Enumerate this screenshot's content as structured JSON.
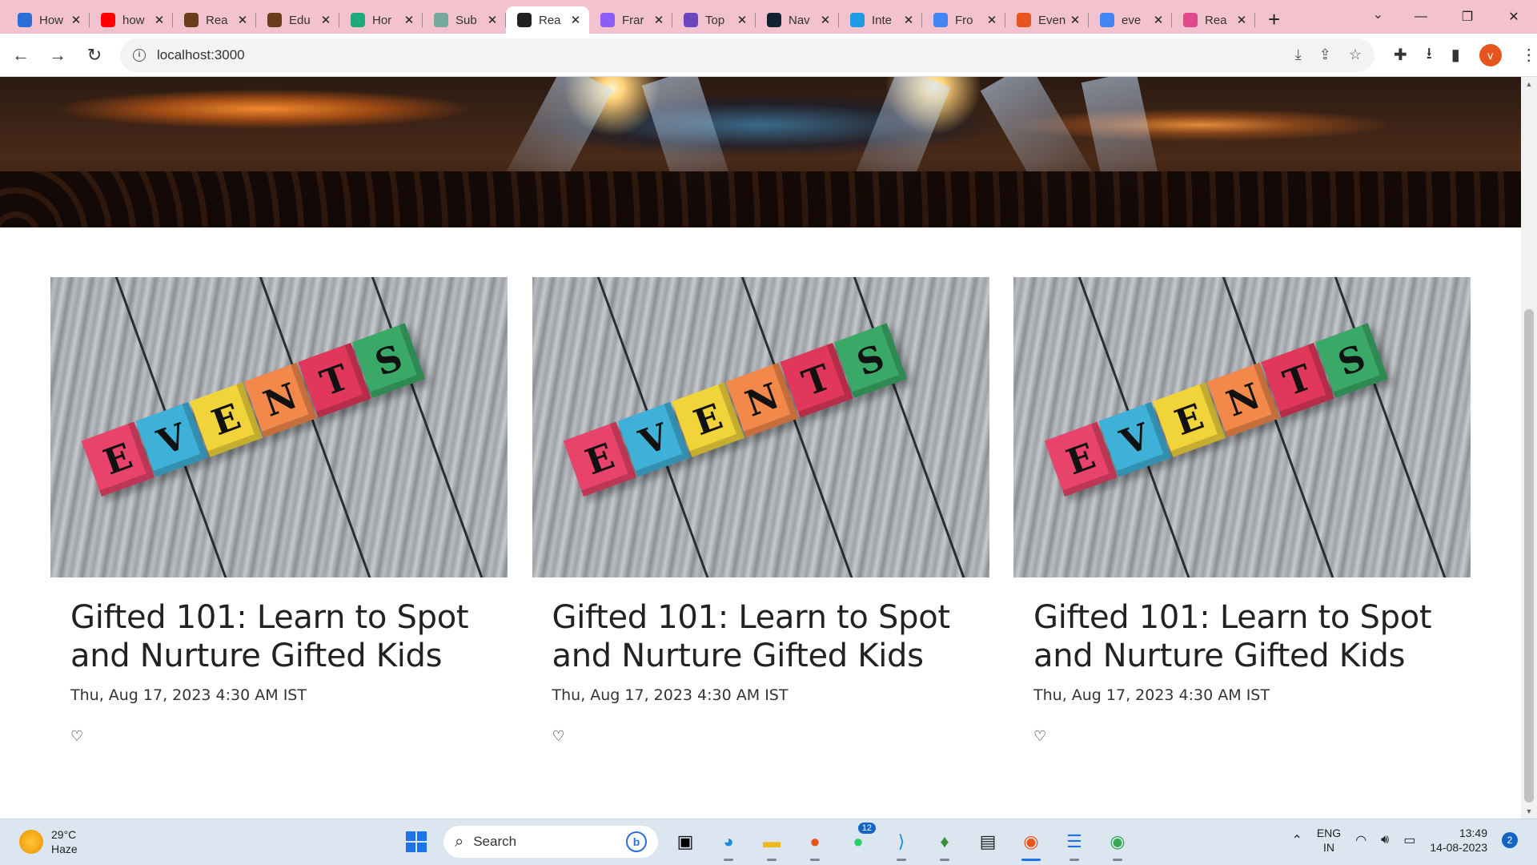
{
  "browser": {
    "tabs": [
      {
        "title": "How",
        "icon": "infinity-icon",
        "color": "#2b6ed6"
      },
      {
        "title": "how",
        "icon": "youtube-icon",
        "color": "#ff0000"
      },
      {
        "title": "Rea",
        "icon": "book-icon",
        "color": "#6b3c1a"
      },
      {
        "title": "Edu",
        "icon": "book-icon",
        "color": "#6b3c1a"
      },
      {
        "title": "Hor",
        "icon": "circle-check-icon",
        "color": "#1ea97c"
      },
      {
        "title": "Sub",
        "icon": "openai-icon",
        "color": "#74aa9c"
      },
      {
        "title": "Rea",
        "icon": "react-icon",
        "color": "#222222",
        "active": true
      },
      {
        "title": "Frar",
        "icon": "framer-icon",
        "color": "#8b5cf6"
      },
      {
        "title": "Top",
        "icon": "bell-icon",
        "color": "#6b46c1"
      },
      {
        "title": "Nav",
        "icon": "rb-icon",
        "color": "#112233"
      },
      {
        "title": "Inte",
        "icon": "is-icon",
        "color": "#1b9ce3"
      },
      {
        "title": "Fro",
        "icon": "doc-icon",
        "color": "#4285f4"
      },
      {
        "title": "Even",
        "icon": "e-icon",
        "color": "#e8541e"
      },
      {
        "title": "eve",
        "icon": "google-icon",
        "color": "#4285f4"
      },
      {
        "title": "Rea",
        "icon": "react-icon",
        "color": "#e04a8c"
      }
    ],
    "new_tab": "+",
    "url": "localhost:3000",
    "profile_initial": "v"
  },
  "events": [
    {
      "title": "Gifted 101: Learn to Spot and Nurture Gifted Kids",
      "date": "Thu, Aug 17, 2023 4:30 AM IST",
      "cubes": [
        "E",
        "V",
        "E",
        "N",
        "T",
        "S"
      ]
    },
    {
      "title": "Gifted 101: Learn to Spot and Nurture Gifted Kids",
      "date": "Thu, Aug 17, 2023 4:30 AM IST",
      "cubes": [
        "E",
        "V",
        "E",
        "N",
        "T",
        "S"
      ]
    },
    {
      "title": "Gifted 101: Learn to Spot and Nurture Gifted Kids",
      "date": "Thu, Aug 17, 2023 4:30 AM IST",
      "cubes": [
        "E",
        "V",
        "E",
        "N",
        "T",
        "S"
      ]
    }
  ],
  "cube_colors": [
    "#e8436a",
    "#3fb0d8",
    "#f1d33a",
    "#f2884a",
    "#e0375a",
    "#3aa866"
  ],
  "taskbar": {
    "weather_temp": "29°C",
    "weather_desc": "Haze",
    "search_placeholder": "Search",
    "whatsapp_badge": "12",
    "lang_line1": "ENG",
    "lang_line2": "IN",
    "time": "13:49",
    "date": "14-08-2023",
    "notifications": "2"
  }
}
